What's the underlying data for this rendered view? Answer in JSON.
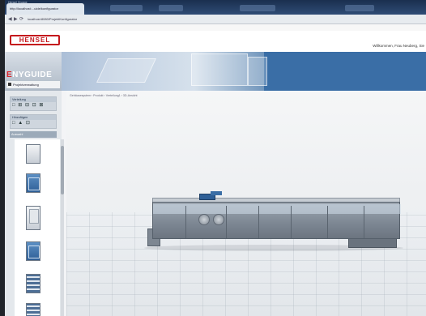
{
  "browser": {
    "window_title": "Hensel Gruppe",
    "tab_label": "http://localhost:...uide/konfigurator",
    "url": "localhost:8080/ProjektKonfigurator",
    "nav": [
      "◀",
      "▶",
      "⟳"
    ]
  },
  "header": {
    "logo_text": "HENSEL",
    "welcome_text": "Willkommen, Frau Neuberg, Sie"
  },
  "sidebar": {
    "brand_prefix": "E",
    "brand_rest": "NYGUIDE",
    "project_label": "Projektverwaltung",
    "sections": [
      {
        "title": "Verteilung",
        "icons": "□ ⊞ ⊟ ⊡ ⊠"
      },
      {
        "title": "Hinzufügen",
        "icons": "□ ▲ ⊡"
      }
    ],
    "auswahl_label": "Auswahl"
  },
  "main": {
    "breadcrumb": "Gehäusesystem › Produkt › Verteilung1 › 3D-Ansicht"
  },
  "thumbnails": [
    {
      "label": "cabinet-plain"
    },
    {
      "label": "cabinet-blue"
    },
    {
      "label": "cabinet-door"
    },
    {
      "label": "cabinet-blue"
    },
    {
      "label": "cabinet-grid"
    },
    {
      "label": "cabinet-grid"
    }
  ],
  "colors": {
    "brand_red": "#c4161c",
    "banner_blue": "#3a6ea6",
    "cabinet_grey": "#7c8692"
  }
}
